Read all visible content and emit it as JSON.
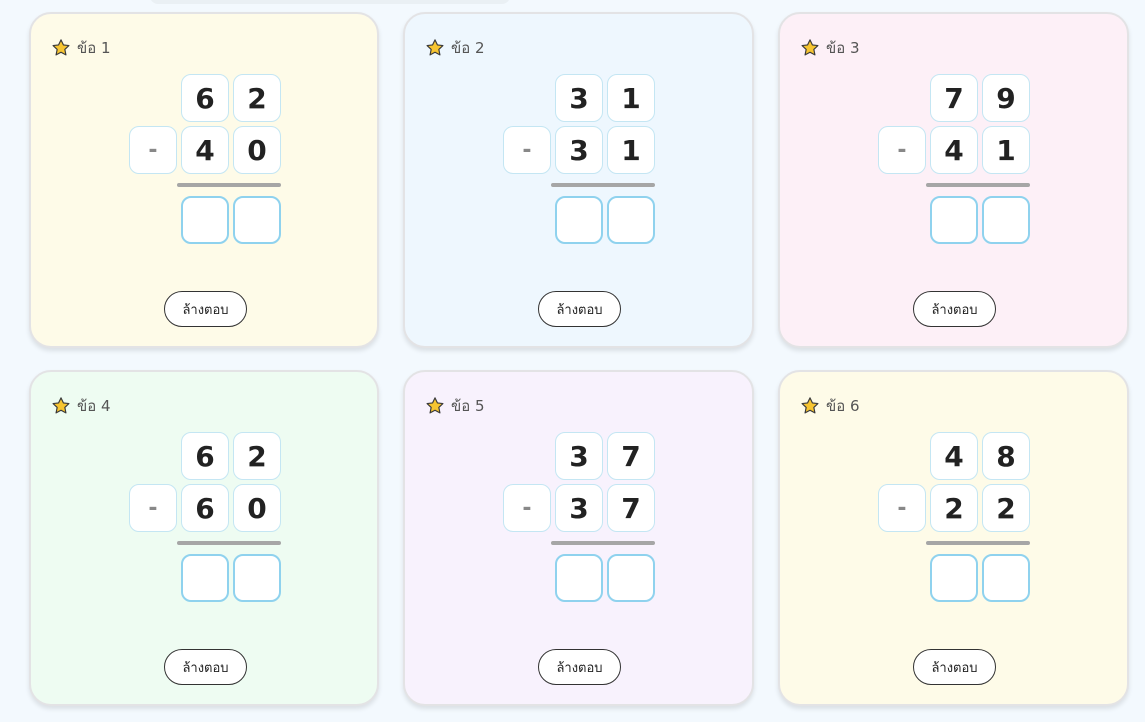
{
  "problems": [
    {
      "label": "ข้อ 1",
      "top": [
        "6",
        "2"
      ],
      "operator": "-",
      "bottom": [
        "4",
        "0"
      ],
      "answer": [
        "",
        ""
      ],
      "bg": "#fefbe8",
      "clear_label": "ล้างตอบ"
    },
    {
      "label": "ข้อ 2",
      "top": [
        "3",
        "1"
      ],
      "operator": "-",
      "bottom": [
        "3",
        "1"
      ],
      "answer": [
        "",
        ""
      ],
      "bg": "#eef7fe",
      "clear_label": "ล้างตอบ"
    },
    {
      "label": "ข้อ 3",
      "top": [
        "7",
        "9"
      ],
      "operator": "-",
      "bottom": [
        "4",
        "1"
      ],
      "answer": [
        "",
        ""
      ],
      "bg": "#fdf0f7",
      "clear_label": "ล้างตอบ"
    },
    {
      "label": "ข้อ 4",
      "top": [
        "6",
        "2"
      ],
      "operator": "-",
      "bottom": [
        "6",
        "0"
      ],
      "answer": [
        "",
        ""
      ],
      "bg": "#eefcf2",
      "clear_label": "ล้างตอบ"
    },
    {
      "label": "ข้อ 5",
      "top": [
        "3",
        "7"
      ],
      "operator": "-",
      "bottom": [
        "3",
        "7"
      ],
      "answer": [
        "",
        ""
      ],
      "bg": "#f8f2fd",
      "clear_label": "ล้างตอบ"
    },
    {
      "label": "ข้อ 6",
      "top": [
        "4",
        "8"
      ],
      "operator": "-",
      "bottom": [
        "2",
        "2"
      ],
      "answer": [
        "",
        ""
      ],
      "bg": "#fefbe8",
      "clear_label": "ล้างตอบ"
    }
  ],
  "icons": {
    "problem_marker": "star-icon",
    "star_color": "#f7c531",
    "star_outline": "#3a3a3a"
  }
}
